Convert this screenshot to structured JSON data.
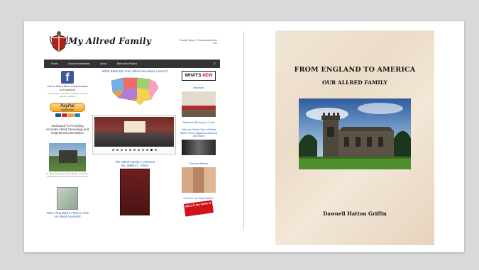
{
  "site": {
    "title": "My Allred Family",
    "tagline": "Family History & Stories and More Fun",
    "nav": [
      "Home",
      "Unsolved Mysteries",
      "About",
      "Allred Info Project"
    ],
    "left": {
      "facebook_text": "Join to Share More Conversations on Facebook",
      "facebook_sub": "The Members only link for family news and Reunion updates",
      "paypal_label": "PayPal",
      "paypal_sub": "DONATE NOW",
      "dedicated": "Dedicated To Providing Accurate Allred Genealogy and Original Documentation",
      "church_caption": "St. Mary the Virgin Church Burton Leonard in England Home Church of the Allred Family",
      "book_link": "Take a Trip Back in Time to Visit our Allred Ancestors"
    },
    "middle": {
      "map_question": "What State Did Your Allred Ancestors Live In?",
      "slider_dots": 11,
      "slider_active_dot": 9,
      "book_link": "The Allred Family In America",
      "book_author": "By: Walter C. Allred"
    },
    "right": {
      "whats_new_a": "WHAT'S",
      "whats_new_b": "NEW",
      "reunions": "Reunions",
      "reunion_banner": "ALLRED REUNION",
      "research": "Research Records & Tools",
      "tour": "Take an Online Tour of Allred Sites From England to America and More",
      "famous": "Famous Allreds",
      "how_find": "How Do You Spell Allred?",
      "hello": "HELLO my name is"
    }
  },
  "cover": {
    "title": "FROM ENGLAND TO AMERICA",
    "subtitle": "OUR ALLRED FAMILY",
    "author": "Dawnell Hatton Griffin"
  }
}
